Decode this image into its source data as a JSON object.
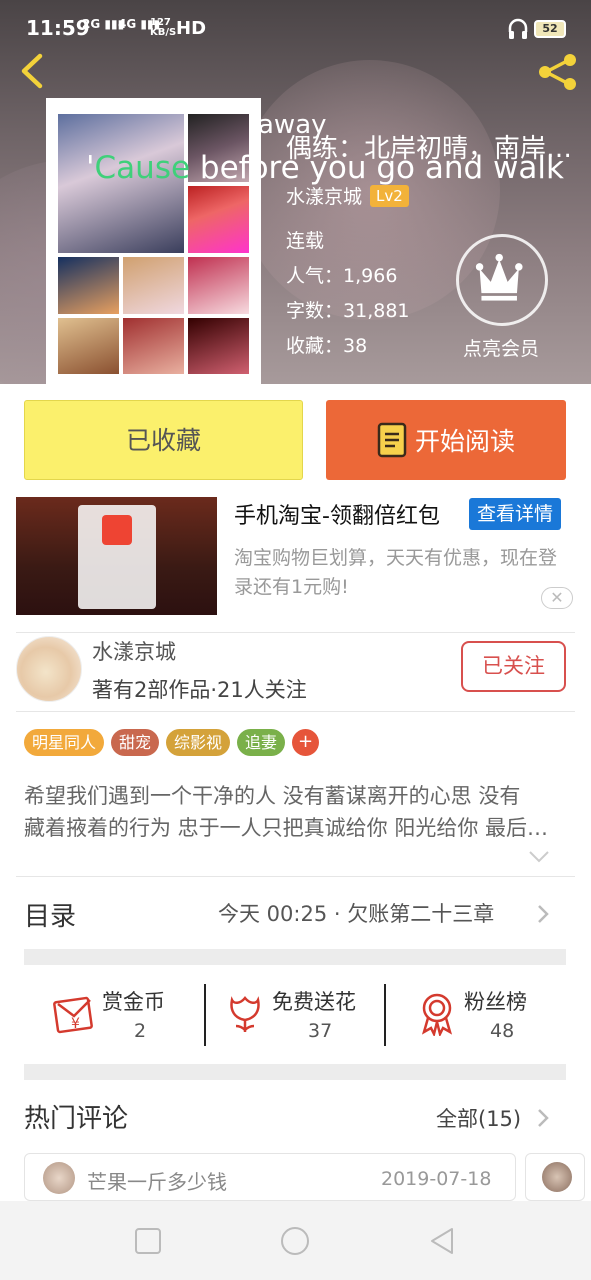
{
  "status_bar": {
    "time": "11:59",
    "net1": "2G",
    "net2": "4G",
    "speed_value": "127",
    "speed_unit": "KB/S",
    "hd": "HD",
    "battery": "52"
  },
  "video_overlay": {
    "line1": "away",
    "line2_highlight": "Cause",
    "line2_prefix": "'",
    "line2_rest": " before you go and walk"
  },
  "book": {
    "title": "偶练：北岸初晴，南岸初晴",
    "author": "水漾京城",
    "author_level": "Lv2",
    "status": "连载",
    "popularity_label": "人气：",
    "popularity": "1,966",
    "words_label": "字数：",
    "words": "31,881",
    "favorites_label": "收藏：",
    "favorites": "38",
    "vip_label": "点亮会员"
  },
  "actions": {
    "favorited_label": "已收藏",
    "start_reading_label": "开始阅读"
  },
  "ad": {
    "title": "手机淘宝-领翻倍红包",
    "button": "查看详情",
    "desc": "淘宝购物巨划算，天天有优惠，现在登录还有1元购!",
    "close": "✕"
  },
  "author_card": {
    "name": "水漾京城",
    "stats": "著有2部作品·21人关注",
    "follow_label": "已关注"
  },
  "tags": [
    {
      "label": "明星同人",
      "color": "#f2a93b"
    },
    {
      "label": "甜宠",
      "color": "#c9684e"
    },
    {
      "label": "综影视",
      "color": "#d4a23a"
    },
    {
      "label": "追妻",
      "color": "#7ab04a"
    }
  ],
  "tag_plus": "+",
  "description": {
    "line1": "希望我们遇到一个干净的人 没有蓄谋离开的心思 没有",
    "line2": "藏着掖着的行为 忠于一人只把真诚给你 阳光给你 最后给你"
  },
  "catalog": {
    "label": "目录",
    "latest": "今天 00:25 · 欠账第二十三章"
  },
  "stats": [
    {
      "label": "赏金币",
      "value": "2",
      "icon": "red-envelope-icon"
    },
    {
      "label": "免费送花",
      "value": "37",
      "icon": "flower-icon"
    },
    {
      "label": "粉丝榜",
      "value": "48",
      "icon": "medal-icon"
    }
  ],
  "comments": {
    "title": "热门评论",
    "all_label": "全部(15)",
    "items": [
      {
        "name": "芒果一斤多少钱",
        "date": "2019-07-18"
      }
    ]
  },
  "colors": {
    "accent_orange": "#ec6838",
    "favorite_yellow": "#fbf06c",
    "follow_red": "#d8504e",
    "ad_blue": "#1a78d8"
  }
}
